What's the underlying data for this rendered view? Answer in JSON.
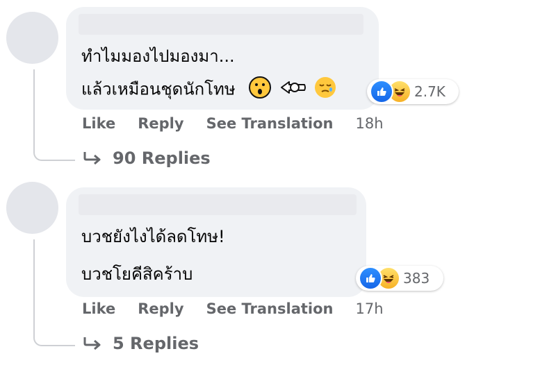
{
  "comments": [
    {
      "line1": "ทำไมมองไปมองมา...",
      "line2": "แล้วเหมือนชุดนักโทษ",
      "reaction_count": "2.7K",
      "actions": {
        "like": "Like",
        "reply": "Reply",
        "translate": "See Translation",
        "time": "18h"
      },
      "replies": "90 Replies"
    },
    {
      "line1": "บวชยังไงได้ลดโทษ!",
      "line2": "บวชโยคีสิคร้าบ",
      "reaction_count": "383",
      "actions": {
        "like": "Like",
        "reply": "Reply",
        "translate": "See Translation",
        "time": "17h"
      },
      "replies": "5 Replies"
    }
  ],
  "icons": {
    "reactions": [
      "like-icon",
      "haha-icon"
    ],
    "inline_emoji": [
      "surprised-face-icon",
      "pointing-hand-icon",
      "sleepy-face-icon"
    ],
    "reply_arrow": "reply-arrow-icon"
  },
  "colors": {
    "like_blue": "#1877f2",
    "haha_yellow": "#f7b125",
    "bubble": "#f0f2f5",
    "meta_text": "#65676b"
  }
}
